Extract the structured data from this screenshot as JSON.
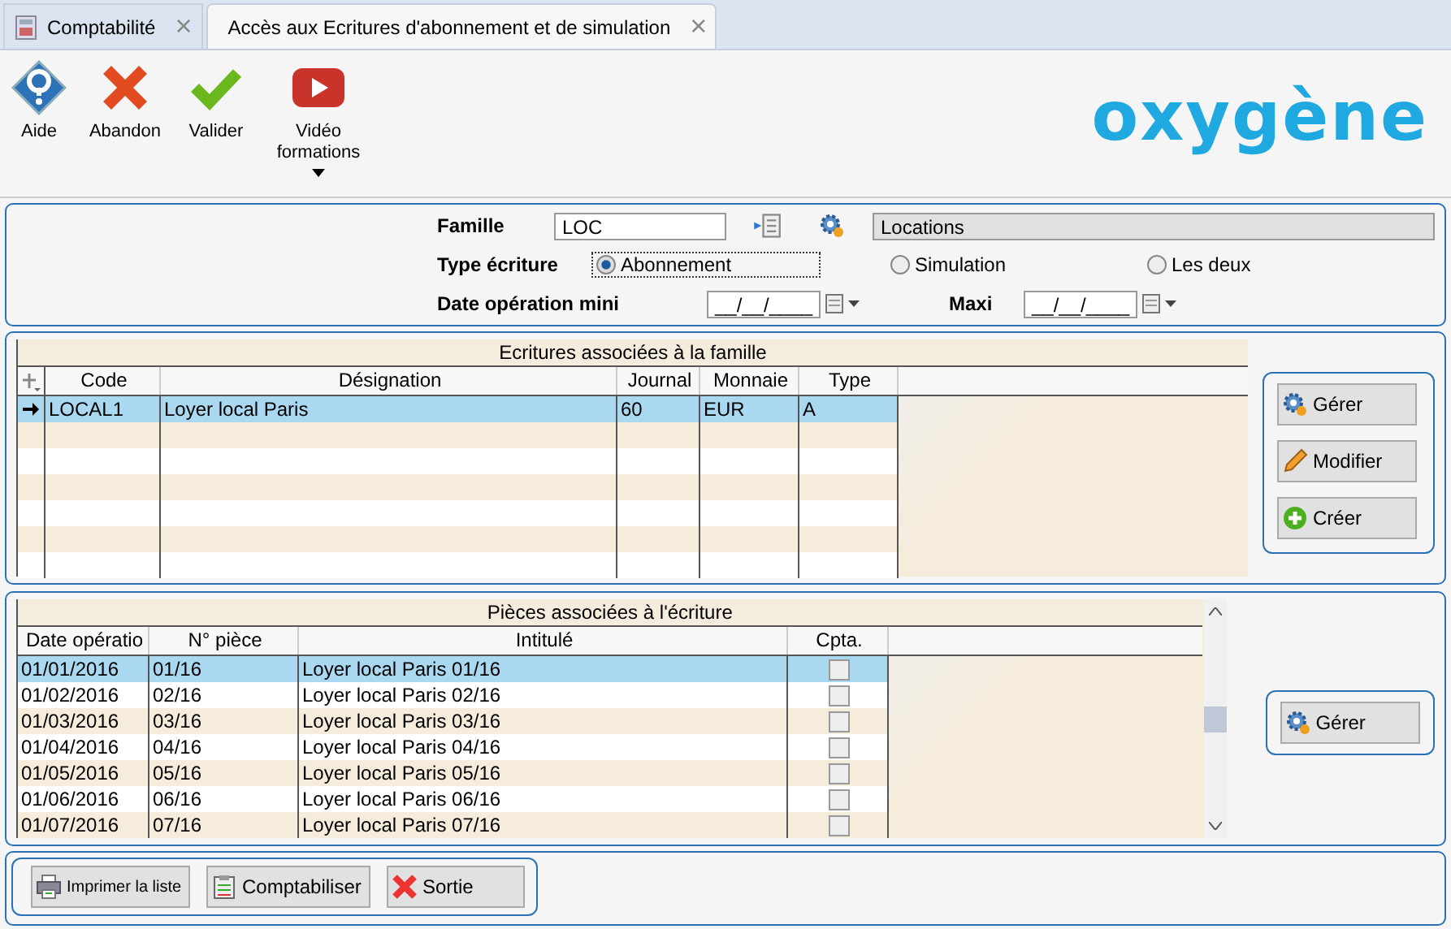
{
  "tabs": [
    {
      "label": "Comptabilité",
      "selected": false,
      "close": "×"
    },
    {
      "label": "Accès aux Ecritures d'abonnement et de simulation",
      "selected": true,
      "close": "×"
    }
  ],
  "toolbar": [
    {
      "kind": "help",
      "label": "Aide"
    },
    {
      "kind": "cancel",
      "label": "Abandon"
    },
    {
      "kind": "ok",
      "label": "Valider"
    },
    {
      "kind": "video",
      "label": "Vidéo formations",
      "dropdown": true
    }
  ],
  "logo": "oxygène",
  "filters": {
    "famille_label": "Famille",
    "famille_value": "LOC",
    "famille_name": "Locations",
    "type_label": "Type écriture",
    "types": [
      {
        "label": "Abonnement",
        "selected": true
      },
      {
        "label": "Simulation",
        "selected": false
      },
      {
        "label": "Les deux",
        "selected": false
      }
    ],
    "date_min_label": "Date opération mini",
    "date_min": "__/__/____",
    "date_max_label": "Maxi",
    "date_max": "__/__/____"
  },
  "ecritures": {
    "title": "Ecritures associées à la famille",
    "columns": [
      "Code",
      "Désignation",
      "Journal",
      "Monnaie",
      "Type"
    ],
    "rows": [
      {
        "selected": true,
        "cells": [
          "LOCAL1",
          "Loyer local Paris",
          "60",
          "EUR",
          "A"
        ]
      }
    ],
    "buttons": [
      {
        "kind": "gear",
        "label": "Gérer"
      },
      {
        "kind": "pencil",
        "label": "Modifier"
      },
      {
        "kind": "plus",
        "label": "Créer"
      }
    ]
  },
  "pieces": {
    "title": "Pièces associées à l'écriture",
    "columns": [
      "Date opératio",
      "N° pièce",
      "Intitulé",
      "Cpta."
    ],
    "rows": [
      {
        "selected": true,
        "cells": [
          "01/01/2016",
          "01/16",
          "Loyer local Paris 01/16"
        ],
        "checked": false
      },
      {
        "selected": false,
        "cells": [
          "01/02/2016",
          "02/16",
          "Loyer local Paris 02/16"
        ],
        "checked": false
      },
      {
        "selected": false,
        "cells": [
          "01/03/2016",
          "03/16",
          "Loyer local Paris 03/16"
        ],
        "checked": false
      },
      {
        "selected": false,
        "cells": [
          "01/04/2016",
          "04/16",
          "Loyer local Paris 04/16"
        ],
        "checked": false
      },
      {
        "selected": false,
        "cells": [
          "01/05/2016",
          "05/16",
          "Loyer local Paris 05/16"
        ],
        "checked": false
      },
      {
        "selected": false,
        "cells": [
          "01/06/2016",
          "06/16",
          "Loyer local Paris 06/16"
        ],
        "checked": false
      },
      {
        "selected": false,
        "cells": [
          "01/07/2016",
          "07/16",
          "Loyer local Paris 07/16"
        ],
        "checked": false
      }
    ],
    "buttons": [
      {
        "kind": "gear",
        "label": "Gérer"
      }
    ]
  },
  "footer": [
    {
      "kind": "print",
      "label": "Imprimer la liste"
    },
    {
      "kind": "ledger",
      "label": "Comptabiliser"
    },
    {
      "kind": "exit",
      "label": "Sortie"
    }
  ]
}
